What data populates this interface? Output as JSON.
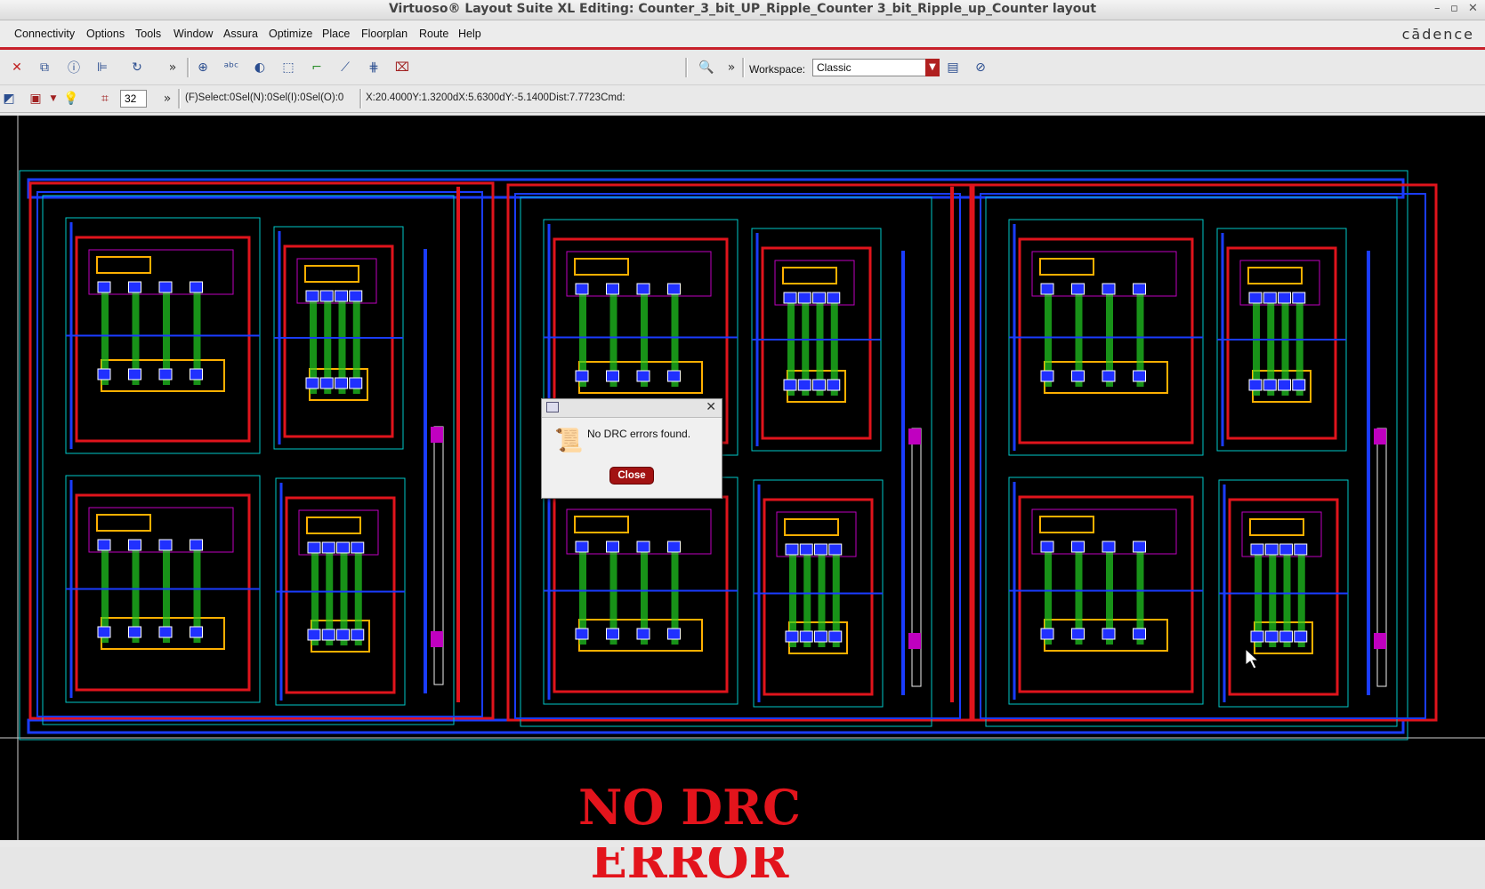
{
  "window": {
    "title": "Virtuoso® Layout Suite XL Editing: Counter_3_bit_UP_Ripple_Counter 3_bit_Ripple_up_Counter layout"
  },
  "menubar": {
    "items": [
      "Connectivity",
      "Options",
      "Tools",
      "Window",
      "Assura",
      "Optimize",
      "Place",
      "Floorplan",
      "Route",
      "Help"
    ],
    "brand": "cādence"
  },
  "toolbar": {
    "workspace_label": "Workspace:",
    "workspace_value": "Classic",
    "overflow_label": "»"
  },
  "statusbar": {
    "display_depth": "32",
    "selection": "(F)Select:0Sel(N):0Sel(I):0Sel(O):0",
    "coords": "X:20.4000Y:1.3200dX:5.6300dY:-5.1400Dist:7.7723Cmd:"
  },
  "dialog": {
    "message": "No DRC errors found.",
    "close_label": "Close"
  },
  "canvas": {
    "banner": "NO DRC ERROR",
    "layer_colors": {
      "background": "#000000",
      "boundary": "#00c8c8",
      "metal1": "#1a3cff",
      "metal2": "#e0141c",
      "poly": "#22d022",
      "active": "#ffb000",
      "nwell": "#c000c0",
      "contact": "#ffffff"
    },
    "counter_stages": 3
  }
}
